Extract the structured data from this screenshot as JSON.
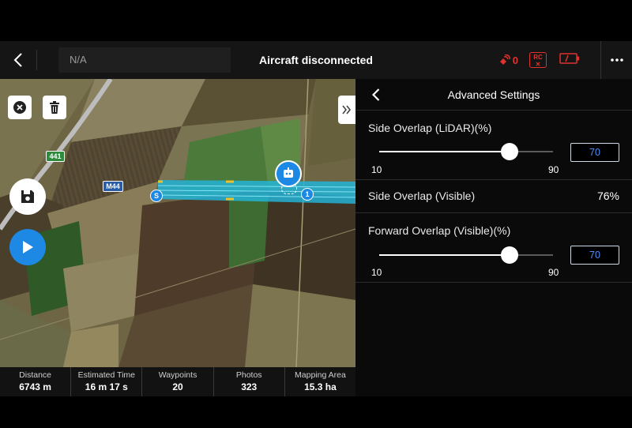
{
  "topbar": {
    "mission_name": "N/A",
    "status": "Aircraft disconnected",
    "signal_count": "0",
    "rc_badge_line1": "RC",
    "rc_badge_line2": "✕"
  },
  "map": {
    "road_labels": [
      "441",
      "M44"
    ],
    "start_marker": "S",
    "waypoint_marker": "1"
  },
  "stats": [
    {
      "label": "Distance",
      "value": "6743 m"
    },
    {
      "label": "Estimated Time",
      "value": "16 m 17 s"
    },
    {
      "label": "Waypoints",
      "value": "20"
    },
    {
      "label": "Photos",
      "value": "323"
    },
    {
      "label": "Mapping Area",
      "value": "15.3 ha"
    }
  ],
  "panel": {
    "title": "Advanced Settings",
    "side_overlap_lidar": {
      "label": "Side Overlap (LiDAR)(%)",
      "min": "10",
      "max": "90",
      "value": "70",
      "fraction": 0.75
    },
    "side_overlap_visible": {
      "label": "Side Overlap (Visible)",
      "value": "76%"
    },
    "forward_overlap_visible": {
      "label": "Forward Overlap (Visible)(%)",
      "min": "10",
      "max": "90",
      "value": "70",
      "fraction": 0.75
    }
  },
  "colors": {
    "accent_blue": "#1e88e5",
    "alert_red": "#e0322f",
    "input_text_blue": "#4d8cff",
    "route_cyan": "#23b3d6"
  }
}
